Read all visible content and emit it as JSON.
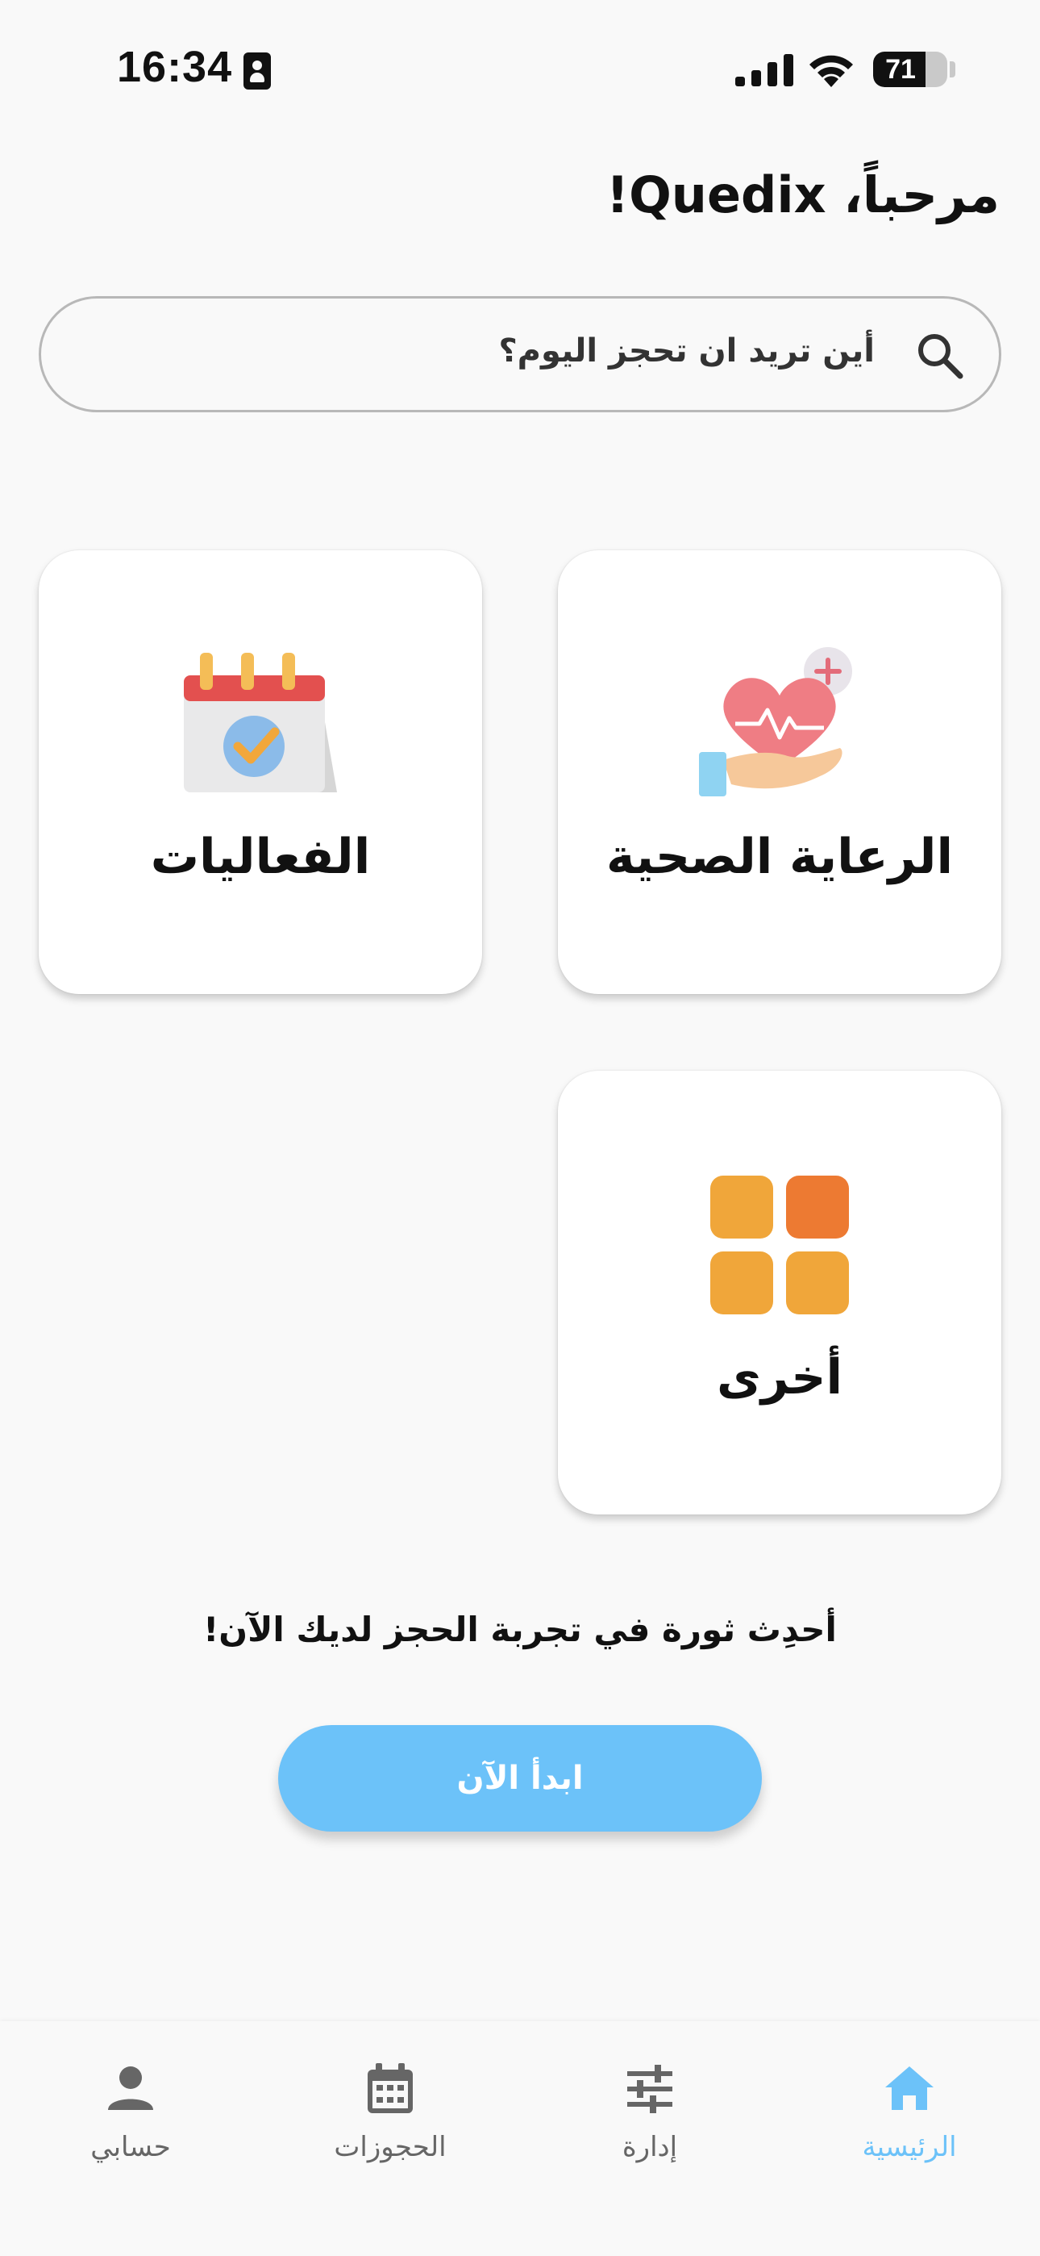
{
  "status_bar": {
    "time": "16:34",
    "battery_level": "71",
    "battery_fraction": 0.71
  },
  "greeting": "مرحباً، Quedix!",
  "search": {
    "placeholder": "أين تريد ان تحجز اليوم؟",
    "icon": "search-icon"
  },
  "categories": [
    {
      "label": "الرعاية الصحية",
      "icon": "healthcare-heart-hand-icon"
    },
    {
      "label": "الفعاليات",
      "icon": "events-calendar-check-icon"
    },
    {
      "label": "أخرى",
      "icon": "other-grid-icon"
    }
  ],
  "promo": {
    "text": "أحدِث ثورة في تجربة الحجز لديك الآن!",
    "button_label": "ابدأ الآن"
  },
  "bottom_nav": {
    "items": [
      {
        "label": "الرئيسية",
        "icon": "home-icon",
        "active": true
      },
      {
        "label": "إدارة",
        "icon": "sliders-icon",
        "active": false
      },
      {
        "label": "الحجوزات",
        "icon": "calendar-icon",
        "active": false
      },
      {
        "label": "حسابي",
        "icon": "person-icon",
        "active": false
      }
    ]
  },
  "colors": {
    "accent": "#6cc2f9",
    "background": "#f9f9f9",
    "card": "#ffffff"
  }
}
